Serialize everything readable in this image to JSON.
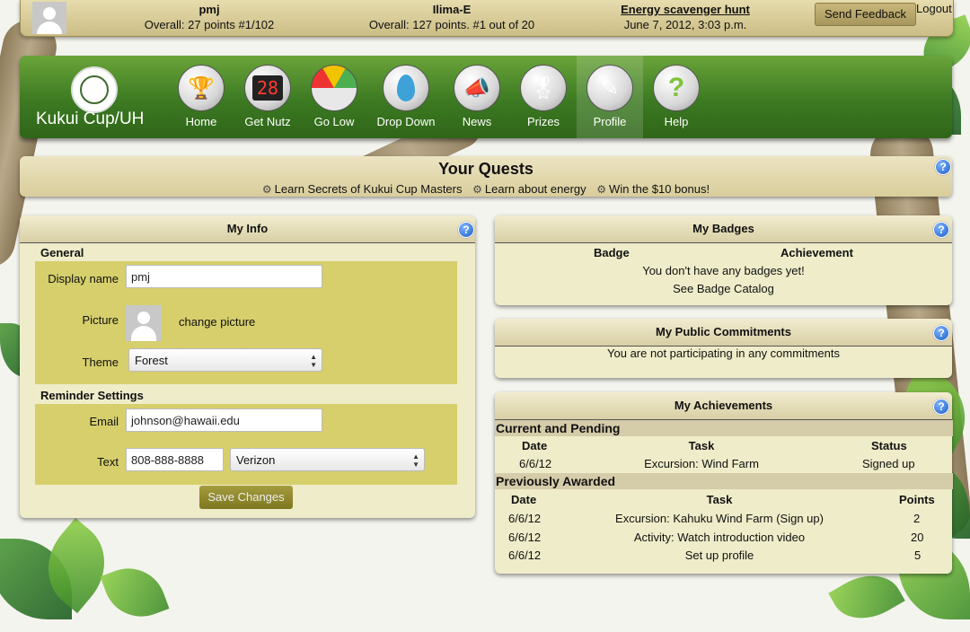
{
  "topbar": {
    "user": {
      "name": "pmj",
      "stats": "Overall: 27 points #1/102"
    },
    "team": {
      "name": "Ilima-E",
      "stats": "Overall: 127 points. #1 out of 20"
    },
    "event": {
      "name": "Energy scavenger hunt",
      "datetime": "June 7, 2012, 3:03 p.m."
    },
    "feedback_label": "Send Feedback",
    "logout_label": "Logout"
  },
  "nav": {
    "brand": "Kukui Cup/UH",
    "items": [
      {
        "label": "Home",
        "icon": "trophy-icon"
      },
      {
        "label": "Get Nutz",
        "icon": "scoreboard-icon",
        "display": "28"
      },
      {
        "label": "Go Low",
        "icon": "gauge-icon"
      },
      {
        "label": "Drop Down",
        "icon": "water-drop-icon"
      },
      {
        "label": "News",
        "icon": "megaphone-icon"
      },
      {
        "label": "Prizes",
        "icon": "ribbon-icon"
      },
      {
        "label": "Profile",
        "icon": "profile-pencil-icon"
      },
      {
        "label": "Help",
        "icon": "question-icon"
      }
    ],
    "active": "Profile"
  },
  "quests": {
    "title": "Your Quests",
    "items": [
      "Learn Secrets of Kukui Cup Masters",
      "Learn about energy",
      "Win the $10 bonus!"
    ]
  },
  "my_info": {
    "title": "My Info",
    "general_label": "General",
    "display_name_label": "Display name",
    "display_name_value": "pmj",
    "picture_label": "Picture",
    "change_picture": "change picture",
    "theme_label": "Theme",
    "theme_value": "Forest",
    "reminder_label": "Reminder Settings",
    "email_label": "Email",
    "email_value": "johnson@hawaii.edu",
    "text_label": "Text",
    "phone_value": "808-888-8888",
    "carrier_value": "Verizon",
    "save_label": "Save Changes"
  },
  "my_badges": {
    "title": "My Badges",
    "col_badge": "Badge",
    "col_achievement": "Achievement",
    "empty_text": "You don't have any badges yet!",
    "catalog_link": "See Badge Catalog"
  },
  "my_commitments": {
    "title": "My Public Commitments",
    "empty_text": "You are not participating in any commitments"
  },
  "my_achievements": {
    "title": "My Achievements",
    "current_label": "Current and Pending",
    "current_headers": {
      "date": "Date",
      "task": "Task",
      "status": "Status"
    },
    "current_rows": [
      {
        "date": "6/6/12",
        "task": "Excursion: Wind Farm",
        "status": "Signed up"
      }
    ],
    "previous_label": "Previously Awarded",
    "previous_headers": {
      "date": "Date",
      "task": "Task",
      "points": "Points"
    },
    "previous_rows": [
      {
        "date": "6/6/12",
        "task": "Excursion: Kahuku Wind Farm (Sign up)",
        "points": "2"
      },
      {
        "date": "6/6/12",
        "task": "Activity: Watch introduction video",
        "points": "20"
      },
      {
        "date": "6/6/12",
        "task": "Set up profile",
        "points": "5"
      }
    ]
  },
  "colors": {
    "nav_green": "#3c7a22",
    "panel_bg": "#efecc9",
    "olive": "#d6cf6c",
    "help_blue": "#1d5fc4"
  }
}
